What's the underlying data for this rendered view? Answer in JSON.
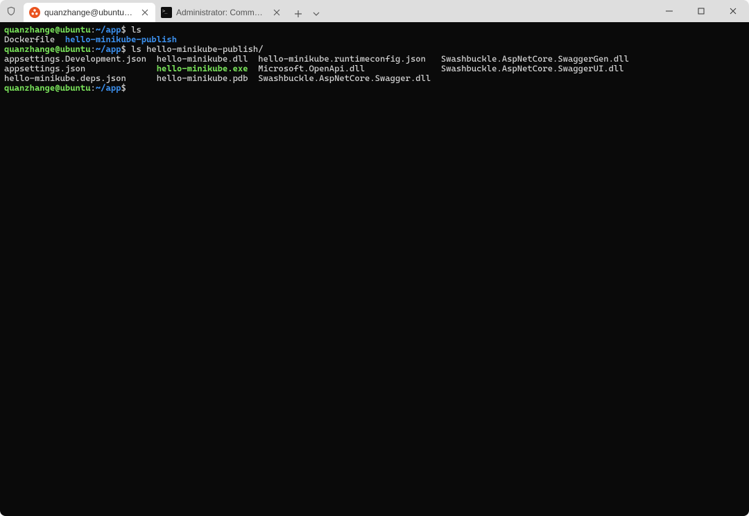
{
  "titlebar": {
    "tabs": [
      {
        "title": "quanzhange@ubuntu: ~/app",
        "icon": "ubuntu",
        "active": true
      },
      {
        "title": "Administrator: Command Prom",
        "icon": "cmd",
        "active": false
      }
    ]
  },
  "prompt": {
    "user_host": "quanzhange@ubuntu",
    "sep": ":",
    "path": "~/app",
    "sym": "$"
  },
  "session": {
    "cmd1": "ls",
    "out1": {
      "dockerfile": "Dockerfile",
      "dir": "hello-minikube-publish"
    },
    "cmd2": "ls hello-minikube-publish/",
    "out2": {
      "col1": [
        "appsettings.Development.json",
        "appsettings.json",
        "hello-minikube.deps.json"
      ],
      "col2": [
        "hello-minikube.dll",
        "hello-minikube.exe",
        "hello-minikube.pdb"
      ],
      "col3": [
        "hello-minikube.runtimeconfig.json",
        "Microsoft.OpenApi.dll",
        "Swashbuckle.AspNetCore.Swagger.dll"
      ],
      "col4": [
        "Swashbuckle.AspNetCore.SwaggerGen.dll",
        "Swashbuckle.AspNetCore.SwaggerUI.dll"
      ]
    },
    "col_widths": {
      "c1": 30,
      "c2": 20,
      "c3": 36
    }
  }
}
